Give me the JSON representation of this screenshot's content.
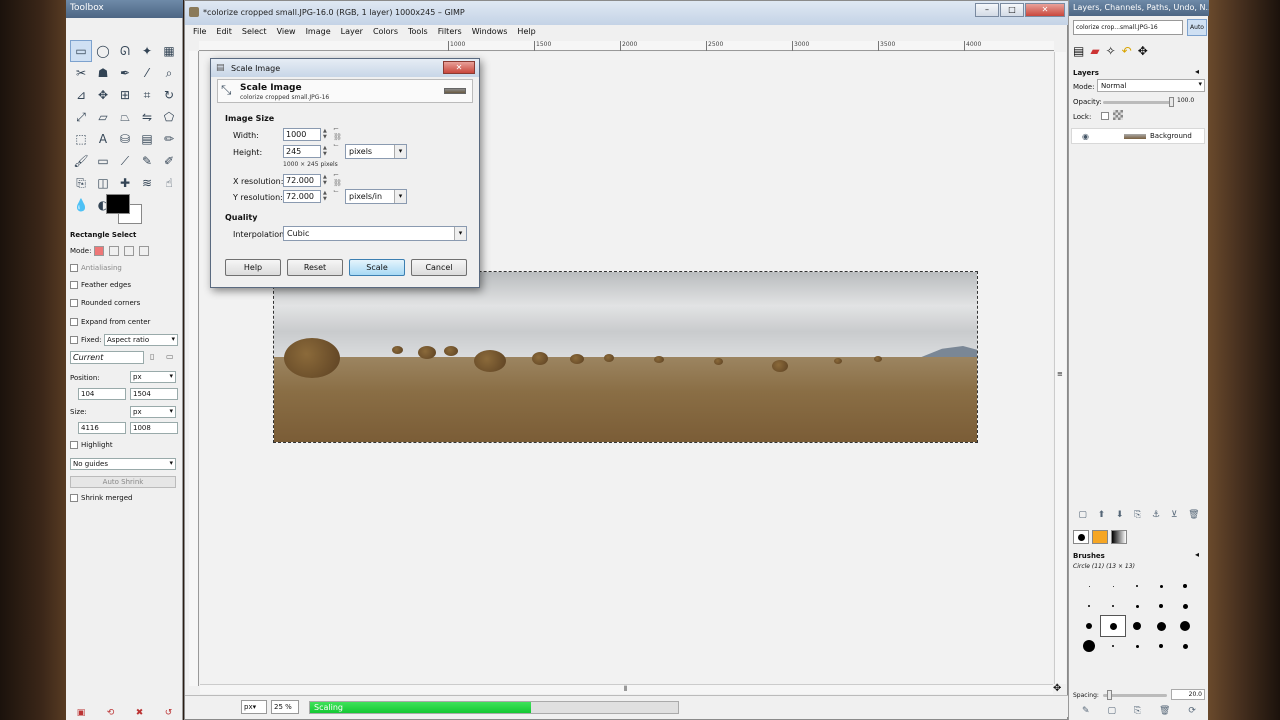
{
  "toolbox": {
    "title": "Toolbox",
    "tool_options_title": "Rectangle Select",
    "mode_label": "Mode:",
    "antialiasing": "Antialiasing",
    "feather_edges": "Feather edges",
    "rounded_corners": "Rounded corners",
    "expand_from_center": "Expand from center",
    "fixed_label": "Fixed:",
    "fixed_value": "Aspect ratio",
    "current_value": "Current",
    "position_label": "Position:",
    "position_unit": "px",
    "position_x": "104",
    "position_y": "1504",
    "size_label": "Size:",
    "size_unit": "px",
    "size_w": "4116",
    "size_h": "1008",
    "highlight": "Highlight",
    "guides_value": "No guides",
    "auto_shrink": "Auto Shrink",
    "shrink_merged": "Shrink merged"
  },
  "main_window": {
    "title": "*colorize cropped small.JPG-16.0 (RGB, 1 layer) 1000x245 – GIMP",
    "menus": [
      "File",
      "Edit",
      "Select",
      "View",
      "Image",
      "Layer",
      "Colors",
      "Tools",
      "Filters",
      "Windows",
      "Help"
    ],
    "ruler_ticks": [
      "1000",
      "1500",
      "2000",
      "2500",
      "3000",
      "3500",
      "4000"
    ],
    "status_unit": "px",
    "zoom": "25 %",
    "progress_label": "Scaling",
    "progress_fraction": 0.6
  },
  "dialog": {
    "title": "Scale Image",
    "header_title": "Scale Image",
    "header_subtitle": "colorize cropped small.JPG-16",
    "image_size_label": "Image Size",
    "width_label": "Width:",
    "width_value": "1000",
    "height_label": "Height:",
    "height_value": "245",
    "size_unit": "pixels",
    "size_note": "1000 × 245 pixels",
    "xres_label": "X resolution:",
    "xres_value": "72.000",
    "yres_label": "Y resolution:",
    "yres_value": "72.000",
    "res_unit": "pixels/in",
    "quality_label": "Quality",
    "interp_label": "Interpolation:",
    "interp_value": "Cubic",
    "help_button": "Help",
    "reset_button": "Reset",
    "scale_button": "Scale",
    "cancel_button": "Cancel"
  },
  "dock": {
    "title": "Layers, Channels, Paths, Undo, N...",
    "image_combo": "colorize crop...small.JPG-16",
    "auto_button": "Auto",
    "layers_label": "Layers",
    "mode_label": "Mode:",
    "mode_value": "Normal",
    "opacity_label": "Opacity:",
    "opacity_value": "100.0",
    "lock_label": "Lock:",
    "layer_name": "Background",
    "brushes_label": "Brushes",
    "brush_name": "Circle (11) (13 × 13)",
    "spacing_label": "Spacing:",
    "spacing_value": "20.0"
  }
}
